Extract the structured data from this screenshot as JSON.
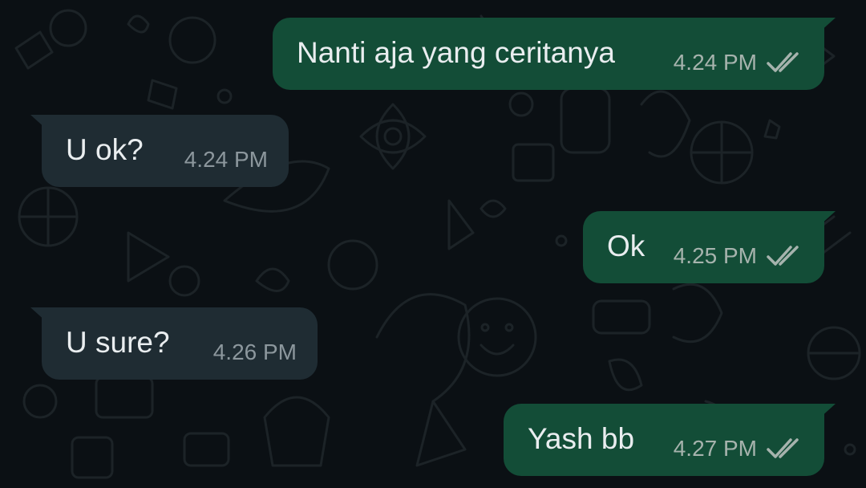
{
  "colors": {
    "outgoing_bubble": "#134d37",
    "incoming_bubble": "#1f2c33",
    "background": "#0b1014",
    "message_text": "#e9edef",
    "time_text": "#a6b3ad",
    "read_ticks": "#a6b3ad"
  },
  "messages": [
    {
      "direction": "outgoing",
      "text": "Nanti aja yang ceritanya",
      "time": "4.24 PM",
      "status_icon": "double-check-icon"
    },
    {
      "direction": "incoming",
      "text": "U ok?",
      "time": "4.24 PM"
    },
    {
      "direction": "outgoing",
      "text": "Ok",
      "time": "4.25 PM",
      "status_icon": "double-check-icon"
    },
    {
      "direction": "incoming",
      "text": "U sure?",
      "time": "4.26 PM"
    },
    {
      "direction": "outgoing",
      "text": "Yash bb",
      "time": "4.27 PM",
      "status_icon": "double-check-icon"
    }
  ]
}
